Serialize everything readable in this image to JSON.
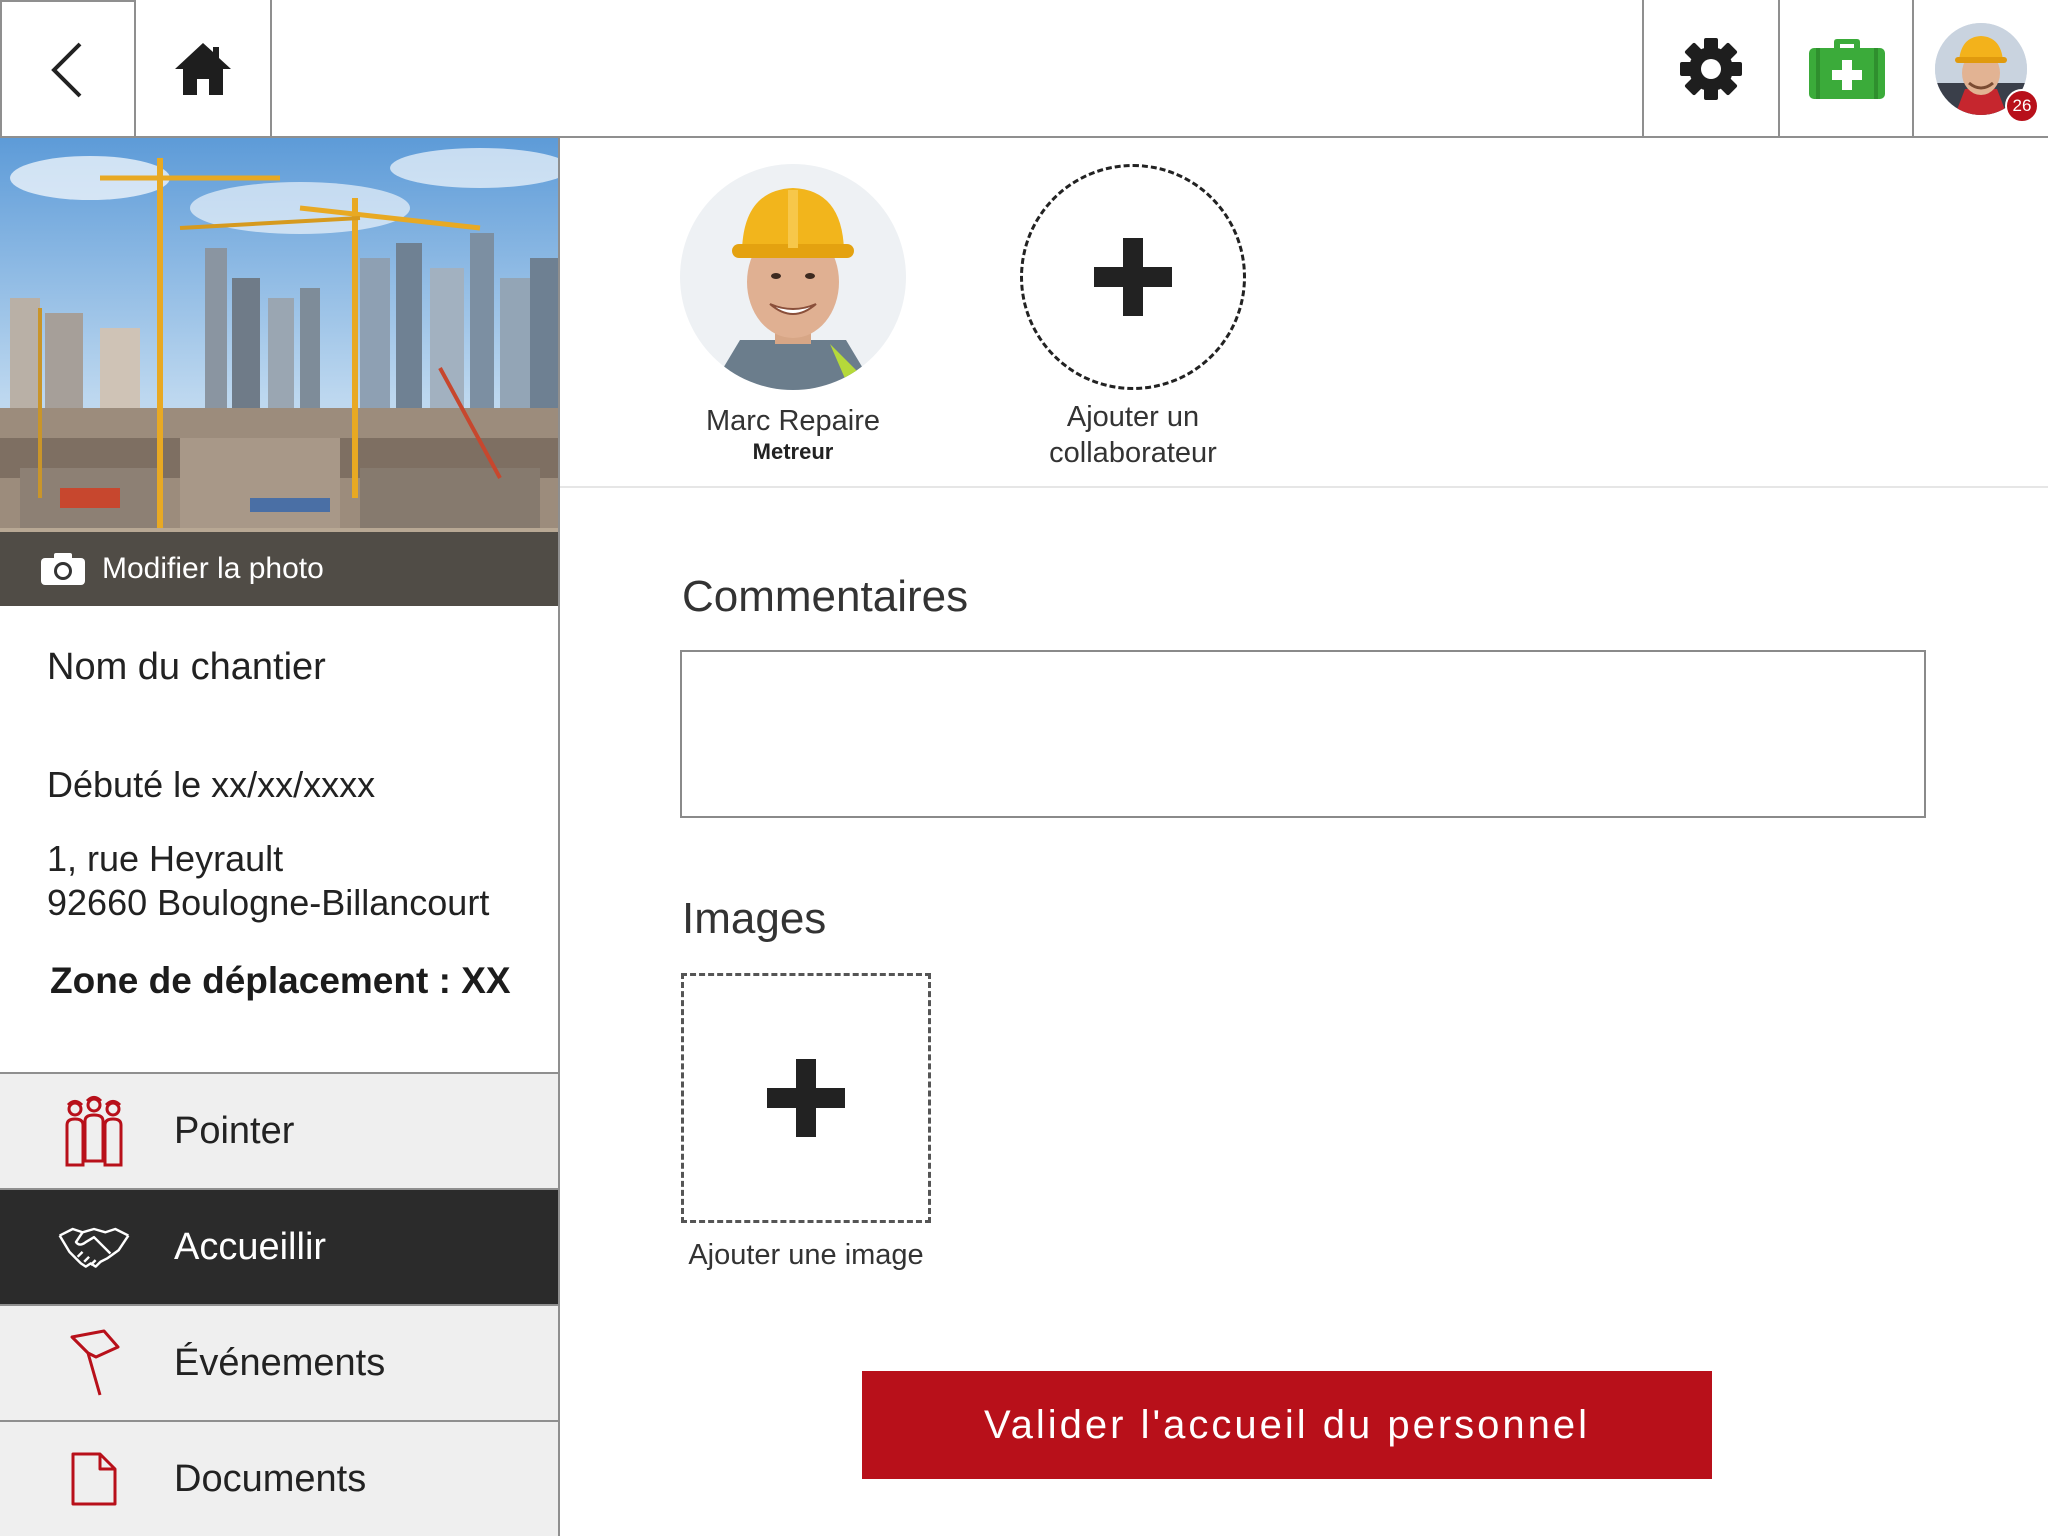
{
  "topbar": {
    "back_icon": "chevron-left-icon",
    "home_icon": "home-icon",
    "settings_icon": "gear-icon",
    "medkit_icon": "first-aid-kit-icon",
    "notification_count": "26"
  },
  "site": {
    "photo_action": "Modifier la photo",
    "name": "Nom du chantier",
    "start_date": "Débuté le xx/xx/xxxx",
    "address_line1": "1, rue Heyrault",
    "address_line2": "92660 Boulogne-Billancourt",
    "zone": "Zone de déplacement : XX"
  },
  "nav": {
    "items": [
      {
        "label": "Pointer",
        "icon": "workers-icon",
        "active": false
      },
      {
        "label": "Accueillir",
        "icon": "handshake-icon",
        "active": true
      },
      {
        "label": "Événements",
        "icon": "flag-icon",
        "active": false
      },
      {
        "label": "Documents",
        "icon": "document-icon",
        "active": false
      }
    ]
  },
  "collaborators": {
    "people": [
      {
        "name": "Marc Repaire",
        "role": "Metreur"
      }
    ],
    "add_label_line1": "Ajouter un",
    "add_label_line2": "collaborateur"
  },
  "comments": {
    "title": "Commentaires",
    "value": "",
    "placeholder": ""
  },
  "images": {
    "title": "Images",
    "add_label": "Ajouter une image"
  },
  "submit_label": "Valider l'accueil du personnel",
  "colors": {
    "accent_red": "#b8101a",
    "medkit_green": "#3bab3a",
    "active_nav": "#2b2b2b",
    "nav_bg": "#efefef"
  }
}
